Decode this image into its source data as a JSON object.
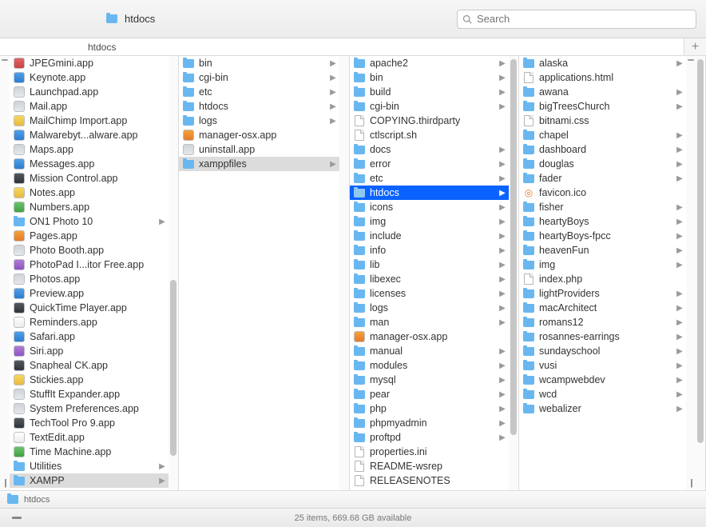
{
  "window_title": "htdocs",
  "path_tab": "htdocs",
  "search": {
    "placeholder": "Search"
  },
  "columns": {
    "c1": [
      {
        "name": "JPEGmini.app",
        "type": "app",
        "tone": "red",
        "nav": false
      },
      {
        "name": "Keynote.app",
        "type": "app",
        "tone": "blue",
        "nav": false
      },
      {
        "name": "Launchpad.app",
        "type": "app",
        "tone": "",
        "nav": false
      },
      {
        "name": "Mail.app",
        "type": "app",
        "tone": "",
        "nav": false
      },
      {
        "name": "MailChimp Import.app",
        "type": "app",
        "tone": "yellow",
        "nav": false
      },
      {
        "name": "Malwarebyt...alware.app",
        "type": "app",
        "tone": "blue",
        "nav": false
      },
      {
        "name": "Maps.app",
        "type": "app",
        "tone": "",
        "nav": false
      },
      {
        "name": "Messages.app",
        "type": "app",
        "tone": "blue",
        "nav": false
      },
      {
        "name": "Mission Control.app",
        "type": "app",
        "tone": "dark",
        "nav": false
      },
      {
        "name": "Notes.app",
        "type": "app",
        "tone": "yellow",
        "nav": false
      },
      {
        "name": "Numbers.app",
        "type": "app",
        "tone": "green",
        "nav": false
      },
      {
        "name": "ON1 Photo 10",
        "type": "folder",
        "nav": true
      },
      {
        "name": "Pages.app",
        "type": "app",
        "tone": "orange",
        "nav": false
      },
      {
        "name": "Photo Booth.app",
        "type": "app",
        "tone": "",
        "nav": false
      },
      {
        "name": "PhotoPad I...itor Free.app",
        "type": "app",
        "tone": "purple",
        "nav": false
      },
      {
        "name": "Photos.app",
        "type": "app",
        "tone": "",
        "nav": false
      },
      {
        "name": "Preview.app",
        "type": "app",
        "tone": "blue",
        "nav": false
      },
      {
        "name": "QuickTime Player.app",
        "type": "app",
        "tone": "dark",
        "nav": false
      },
      {
        "name": "Reminders.app",
        "type": "app",
        "tone": "white",
        "nav": false
      },
      {
        "name": "Safari.app",
        "type": "app",
        "tone": "blue",
        "nav": false
      },
      {
        "name": "Siri.app",
        "type": "app",
        "tone": "purple",
        "nav": false
      },
      {
        "name": "Snapheal CK.app",
        "type": "app",
        "tone": "dark",
        "nav": false
      },
      {
        "name": "Stickies.app",
        "type": "app",
        "tone": "yellow",
        "nav": false
      },
      {
        "name": "StuffIt Expander.app",
        "type": "app",
        "tone": "",
        "nav": false
      },
      {
        "name": "System Preferences.app",
        "type": "app",
        "tone": "",
        "nav": false
      },
      {
        "name": "TechTool Pro 9.app",
        "type": "app",
        "tone": "dark",
        "nav": false
      },
      {
        "name": "TextEdit.app",
        "type": "app",
        "tone": "white",
        "nav": false
      },
      {
        "name": "Time Machine.app",
        "type": "app",
        "tone": "green",
        "nav": false
      },
      {
        "name": "Utilities",
        "type": "folder",
        "nav": true
      },
      {
        "name": "XAMPP",
        "type": "folder",
        "nav": true,
        "selected": "gray"
      }
    ],
    "c2": [
      {
        "name": "bin",
        "type": "folder",
        "nav": true
      },
      {
        "name": "cgi-bin",
        "type": "folder",
        "nav": true
      },
      {
        "name": "etc",
        "type": "folder",
        "nav": true
      },
      {
        "name": "htdocs",
        "type": "folder",
        "nav": true
      },
      {
        "name": "logs",
        "type": "folder",
        "nav": true
      },
      {
        "name": "manager-osx.app",
        "type": "app",
        "tone": "orange",
        "nav": false
      },
      {
        "name": "uninstall.app",
        "type": "app",
        "tone": "",
        "nav": false
      },
      {
        "name": "xamppfiles",
        "type": "folder",
        "nav": true,
        "selected": "gray"
      }
    ],
    "c3": [
      {
        "name": "apache2",
        "type": "folder",
        "nav": true
      },
      {
        "name": "bin",
        "type": "folder",
        "nav": true
      },
      {
        "name": "build",
        "type": "folder",
        "nav": true
      },
      {
        "name": "cgi-bin",
        "type": "folder",
        "nav": true
      },
      {
        "name": "COPYING.thirdparty",
        "type": "file",
        "nav": false
      },
      {
        "name": "ctlscript.sh",
        "type": "file",
        "nav": false
      },
      {
        "name": "docs",
        "type": "folder",
        "nav": true
      },
      {
        "name": "error",
        "type": "folder",
        "nav": true
      },
      {
        "name": "etc",
        "type": "folder",
        "nav": true
      },
      {
        "name": "htdocs",
        "type": "folder",
        "nav": true,
        "selected": "blue"
      },
      {
        "name": "icons",
        "type": "folder",
        "nav": true
      },
      {
        "name": "img",
        "type": "folder",
        "nav": true
      },
      {
        "name": "include",
        "type": "folder",
        "nav": true
      },
      {
        "name": "info",
        "type": "folder",
        "nav": true
      },
      {
        "name": "lib",
        "type": "folder",
        "nav": true
      },
      {
        "name": "libexec",
        "type": "folder",
        "nav": true
      },
      {
        "name": "licenses",
        "type": "folder",
        "nav": true
      },
      {
        "name": "logs",
        "type": "folder",
        "nav": true
      },
      {
        "name": "man",
        "type": "folder",
        "nav": true
      },
      {
        "name": "manager-osx.app",
        "type": "app",
        "tone": "orange",
        "nav": false
      },
      {
        "name": "manual",
        "type": "folder",
        "nav": true
      },
      {
        "name": "modules",
        "type": "folder",
        "nav": true
      },
      {
        "name": "mysql",
        "type": "folder",
        "nav": true
      },
      {
        "name": "pear",
        "type": "folder",
        "nav": true
      },
      {
        "name": "php",
        "type": "folder",
        "nav": true
      },
      {
        "name": "phpmyadmin",
        "type": "folder",
        "nav": true
      },
      {
        "name": "proftpd",
        "type": "folder",
        "nav": true
      },
      {
        "name": "properties.ini",
        "type": "file",
        "nav": false
      },
      {
        "name": "README-wsrep",
        "type": "file",
        "nav": false
      },
      {
        "name": "RELEASENOTES",
        "type": "file",
        "nav": false
      }
    ],
    "c4": [
      {
        "name": "alaska",
        "type": "folder",
        "nav": true
      },
      {
        "name": "applications.html",
        "type": "file",
        "nav": false
      },
      {
        "name": "awana",
        "type": "folder",
        "nav": true
      },
      {
        "name": "bigTreesChurch",
        "type": "folder",
        "nav": true
      },
      {
        "name": "bitnami.css",
        "type": "file",
        "nav": false
      },
      {
        "name": "chapel",
        "type": "folder",
        "nav": true
      },
      {
        "name": "dashboard",
        "type": "folder",
        "nav": true
      },
      {
        "name": "douglas",
        "type": "folder",
        "nav": true
      },
      {
        "name": "fader",
        "type": "folder",
        "nav": true
      },
      {
        "name": "favicon.ico",
        "type": "favicon",
        "nav": false
      },
      {
        "name": "fisher",
        "type": "folder",
        "nav": true
      },
      {
        "name": "heartyBoys",
        "type": "folder",
        "nav": true
      },
      {
        "name": "heartyBoys-fpcc",
        "type": "folder",
        "nav": true
      },
      {
        "name": "heavenFun",
        "type": "folder",
        "nav": true
      },
      {
        "name": "img",
        "type": "folder",
        "nav": true
      },
      {
        "name": "index.php",
        "type": "file",
        "nav": false
      },
      {
        "name": "lightProviders",
        "type": "folder",
        "nav": true
      },
      {
        "name": "macArchitect",
        "type": "folder",
        "nav": true
      },
      {
        "name": "romans12",
        "type": "folder",
        "nav": true
      },
      {
        "name": "rosannes-earrings",
        "type": "folder",
        "nav": true
      },
      {
        "name": "sundayschool",
        "type": "folder",
        "nav": true
      },
      {
        "name": "vusi",
        "type": "folder",
        "nav": true
      },
      {
        "name": "wcampwebdev",
        "type": "folder",
        "nav": true
      },
      {
        "name": "wcd",
        "type": "folder",
        "nav": true
      },
      {
        "name": "webalizer",
        "type": "folder",
        "nav": true
      }
    ]
  },
  "bottom_path": "htdocs",
  "status": "25 items, 669.68 GB available"
}
